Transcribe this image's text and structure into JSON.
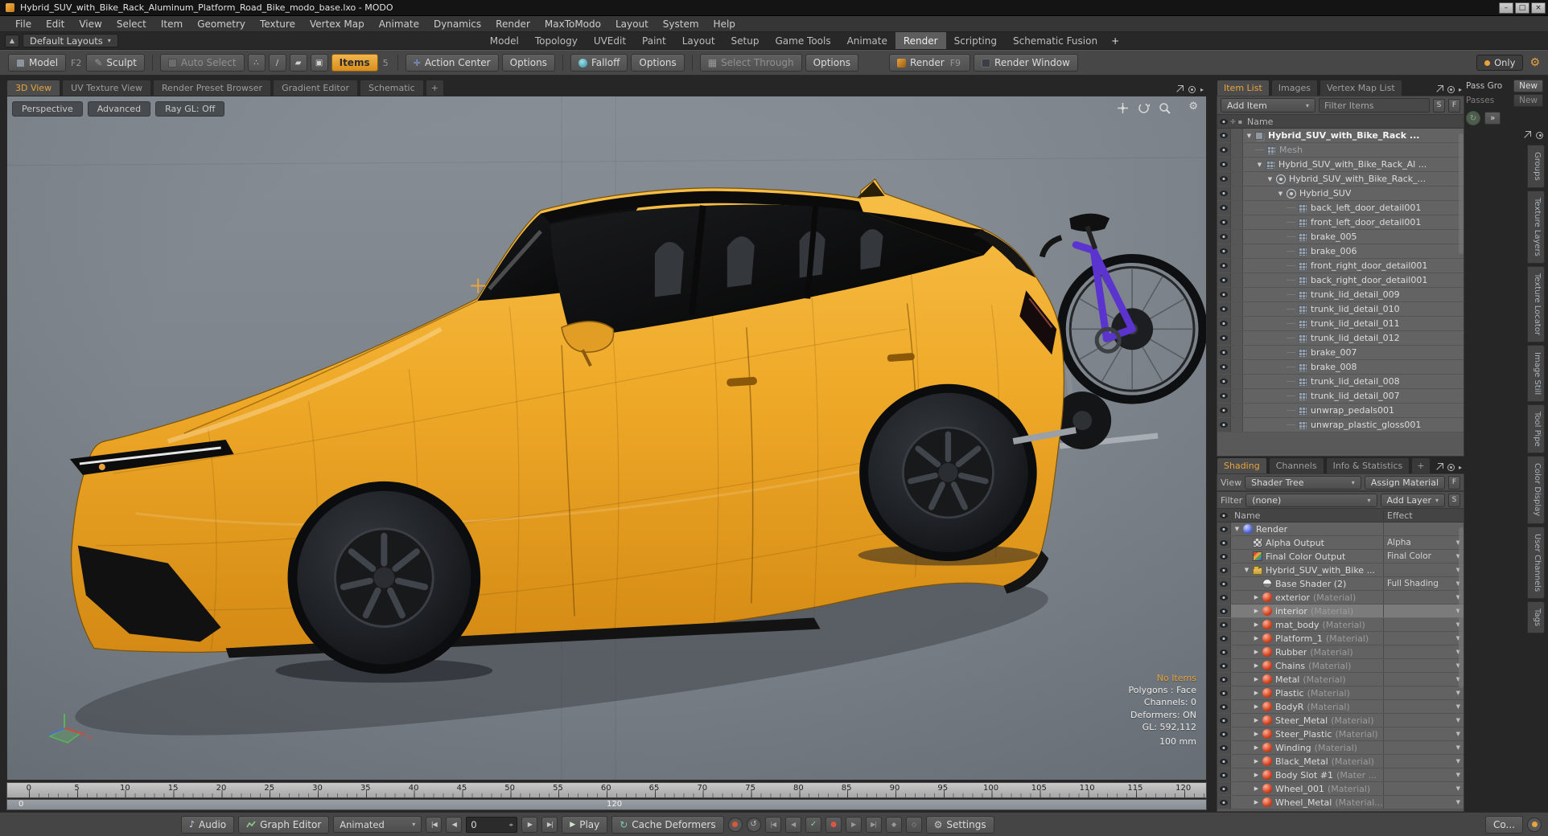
{
  "titlebar": {
    "title": "Hybrid_SUV_with_Bike_Rack_Aluminum_Platform_Road_Bike_modo_base.lxo - MODO"
  },
  "menubar": {
    "items": [
      "File",
      "Edit",
      "View",
      "Select",
      "Item",
      "Geometry",
      "Texture",
      "Vertex Map",
      "Animate",
      "Dynamics",
      "Render",
      "MaxToModo",
      "Layout",
      "System",
      "Help"
    ]
  },
  "layoutbar": {
    "layouts_label": "Default Layouts",
    "tabs": [
      "Model",
      "Topology",
      "UVEdit",
      "Paint",
      "Layout",
      "Setup",
      "Game Tools",
      "Animate",
      "Render",
      "Scripting",
      "Schematic Fusion",
      "+"
    ],
    "active_tab": "Render"
  },
  "toolbar": {
    "model_label": "Model",
    "model_key": "F2",
    "sculpt_label": "Sculpt",
    "auto_select_label": "Auto Select",
    "items_label": "Items",
    "items_key": "5",
    "action_center_label": "Action Center",
    "action_center_options": "Options",
    "falloff_label": "Falloff",
    "falloff_options": "Options",
    "select_through_label": "Select Through",
    "select_through_options": "Options",
    "render_label": "Render",
    "render_key": "F9",
    "render_window_label": "Render Window",
    "only_label": "Only"
  },
  "viewport": {
    "tabs": [
      "3D View",
      "UV Texture View",
      "Render Preset Browser",
      "Gradient Editor",
      "Schematic",
      "+"
    ],
    "active_tab": "3D View",
    "mode_buttons": [
      "Perspective",
      "Advanced",
      "Ray GL: Off"
    ],
    "overlay": {
      "no_items": "No Items",
      "polygons": "Polygons : Face",
      "channels": "Channels: 0",
      "deformers": "Deformers: ON",
      "gl": "GL: 592,112",
      "grid_size": "100 mm"
    }
  },
  "timeline": {
    "ticks": [
      0,
      5,
      10,
      15,
      20,
      25,
      30,
      35,
      40,
      45,
      50,
      55,
      60,
      65,
      70,
      75,
      80,
      85,
      90,
      95,
      100,
      105,
      110,
      115,
      120
    ],
    "range_start": "0",
    "range_end": "120"
  },
  "transport": {
    "audio_label": "Audio",
    "graph_editor_label": "Graph Editor",
    "animated_label": "Animated",
    "frame_value": "0",
    "play_label": "Play",
    "cache_deformers_label": "Cache Deformers",
    "settings_label": "Settings",
    "console_label": "Co..."
  },
  "item_list": {
    "tabs": [
      "Item List",
      "Images",
      "Vertex Map List"
    ],
    "active_tab": "Item List",
    "add_item": "Add Item",
    "filter_items": "Filter Items",
    "s_btn": "S",
    "f_btn": "F",
    "name_header": "Name",
    "rows": [
      {
        "label": "Hybrid_SUV_with_Bike_Rack ...",
        "depth": 0,
        "icon": "scene",
        "bold": true,
        "expanded": true
      },
      {
        "label": "Mesh",
        "depth": 1,
        "icon": "mesh",
        "muted": true
      },
      {
        "label": "Hybrid_SUV_with_Bike_Rack_Al ...",
        "depth": 1,
        "icon": "mesh",
        "expanded": true
      },
      {
        "label": "Hybrid_SUV_with_Bike_Rack_...",
        "depth": 2,
        "icon": "locator",
        "expanded": true
      },
      {
        "label": "Hybrid_SUV",
        "depth": 3,
        "icon": "locator",
        "expanded": true
      },
      {
        "label": "back_left_door_detail001",
        "depth": 4,
        "icon": "mesh"
      },
      {
        "label": "front_left_door_detail001",
        "depth": 4,
        "icon": "mesh"
      },
      {
        "label": "brake_005",
        "depth": 4,
        "icon": "mesh"
      },
      {
        "label": "brake_006",
        "depth": 4,
        "icon": "mesh"
      },
      {
        "label": "front_right_door_detail001",
        "depth": 4,
        "icon": "mesh"
      },
      {
        "label": "back_right_door_detail001",
        "depth": 4,
        "icon": "mesh"
      },
      {
        "label": "trunk_lid_detail_009",
        "depth": 4,
        "icon": "mesh"
      },
      {
        "label": "trunk_lid_detail_010",
        "depth": 4,
        "icon": "mesh"
      },
      {
        "label": "trunk_lid_detail_011",
        "depth": 4,
        "icon": "mesh"
      },
      {
        "label": "trunk_lid_detail_012",
        "depth": 4,
        "icon": "mesh"
      },
      {
        "label": "brake_007",
        "depth": 4,
        "icon": "mesh"
      },
      {
        "label": "brake_008",
        "depth": 4,
        "icon": "mesh"
      },
      {
        "label": "trunk_lid_detail_008",
        "depth": 4,
        "icon": "mesh"
      },
      {
        "label": "trunk_lid_detail_007",
        "depth": 4,
        "icon": "mesh"
      },
      {
        "label": "unwrap_pedals001",
        "depth": 4,
        "icon": "mesh"
      },
      {
        "label": "unwrap_plastic_gloss001",
        "depth": 4,
        "icon": "mesh"
      }
    ]
  },
  "shading": {
    "tabs": [
      "Shading",
      "Channels",
      "Info & Statistics",
      "+"
    ],
    "active_tab": "Shading",
    "view_label": "View",
    "view_value": "Shader Tree",
    "assign_material": "Assign Material",
    "f_btn": "F",
    "filter_label": "Filter",
    "filter_value": "(none)",
    "add_layer": "Add Layer",
    "s_btn": "S",
    "name_header": "Name",
    "effect_header": "Effect",
    "rows": [
      {
        "label": "Render",
        "depth": 0,
        "icon": "rendersphere",
        "expanded": true,
        "effect": "",
        "dropdown": false
      },
      {
        "label": "Alpha Output",
        "depth": 1,
        "icon": "alpha",
        "effect": "Alpha"
      },
      {
        "label": "Final Color Output",
        "depth": 1,
        "icon": "colorout",
        "effect": "Final Color"
      },
      {
        "label": "Hybrid_SUV_with_Bike ...",
        "depth": 1,
        "icon": "folder",
        "expanded": true,
        "effect": ""
      },
      {
        "label": "Base Shader (2)",
        "depth": 2,
        "icon": "shader",
        "effect": "Full Shading"
      },
      {
        "label": "exterior",
        "suffix": "(Material)",
        "depth": 2,
        "icon": "material",
        "collapsible": true,
        "effect": ""
      },
      {
        "label": "interior",
        "suffix": "(Material)",
        "depth": 2,
        "icon": "material",
        "collapsible": true,
        "effect": "",
        "selected": true
      },
      {
        "label": "mat_body",
        "suffix": "(Material)",
        "depth": 2,
        "icon": "material",
        "collapsible": true,
        "effect": ""
      },
      {
        "label": "Platform_1",
        "suffix": "(Material)",
        "depth": 2,
        "icon": "material",
        "collapsible": true,
        "effect": ""
      },
      {
        "label": "Rubber",
        "suffix": "(Material)",
        "depth": 2,
        "icon": "material",
        "collapsible": true,
        "effect": ""
      },
      {
        "label": "Chains",
        "suffix": "(Material)",
        "depth": 2,
        "icon": "material",
        "collapsible": true,
        "effect": ""
      },
      {
        "label": "Metal",
        "suffix": "(Material)",
        "depth": 2,
        "icon": "material",
        "collapsible": true,
        "effect": ""
      },
      {
        "label": "Plastic",
        "suffix": "(Material)",
        "depth": 2,
        "icon": "material",
        "collapsible": true,
        "effect": ""
      },
      {
        "label": "BodyR",
        "suffix": "(Material)",
        "depth": 2,
        "icon": "material",
        "collapsible": true,
        "effect": ""
      },
      {
        "label": "Steer_Metal",
        "suffix": "(Material)",
        "depth": 2,
        "icon": "material",
        "collapsible": true,
        "effect": ""
      },
      {
        "label": "Steer_Plastic",
        "suffix": "(Material)",
        "depth": 2,
        "icon": "material",
        "collapsible": true,
        "effect": ""
      },
      {
        "label": "Winding",
        "suffix": "(Material)",
        "depth": 2,
        "icon": "material",
        "collapsible": true,
        "effect": ""
      },
      {
        "label": "Black_Metal",
        "suffix": "(Material)",
        "depth": 2,
        "icon": "material",
        "collapsible": true,
        "effect": ""
      },
      {
        "label": "Body Slot #1",
        "suffix": "(Mater ...",
        "depth": 2,
        "icon": "material",
        "collapsible": true,
        "effect": ""
      },
      {
        "label": "Wheel_001",
        "suffix": "(Material)",
        "depth": 2,
        "icon": "material",
        "collapsible": true,
        "effect": ""
      },
      {
        "label": "Wheel_Metal",
        "suffix": "(Material...",
        "depth": 2,
        "icon": "material",
        "collapsible": true,
        "effect": ""
      }
    ]
  },
  "right_rail": {
    "pass_group_label": "Pass Gro",
    "pass_group_new": "New",
    "passes_label": "Passes",
    "passes_new": "New",
    "expand_label": "»",
    "vertical_tabs": [
      "Groups",
      "Texture Layers",
      "Texture Locator",
      "Image Still",
      "Tool Pipe",
      "Color Display",
      "User Channels",
      "Tags"
    ]
  },
  "colors": {
    "accent": "#e8a33d",
    "body_paint": "#efa928",
    "bike_frame": "#5b33cf"
  }
}
